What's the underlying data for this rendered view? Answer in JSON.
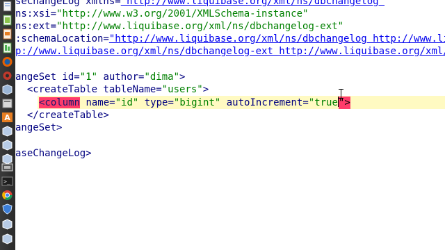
{
  "launcher": {
    "icons": [
      "document-icon",
      "spreadsheet-icon",
      "presentation-icon",
      "spreadsheet-icon-2",
      "firefox-icon",
      "settings-gear-icon",
      "software-center-icon",
      "workspace-icon",
      "font-a-icon",
      "liquibase-icon",
      "liquibase-icon-2",
      "liquibase-icon-3",
      "screenshot-icon",
      "terminal-icon",
      "chrome-icon",
      "shield-icon",
      "liquibase-icon-4",
      "liquibase-icon-5"
    ]
  },
  "editor": {
    "lines": [
      {
        "a": "seChangeLog xmlns=",
        "b": "\"http://www.liquibase.org/xml/ns/dbchangelog\""
      },
      {
        "a": "ns:xsi=",
        "b": "\"http://www.w3.org/2001/XMLSchema-instance\""
      },
      {
        "a": "ns:ext=",
        "b": "\"http://www.liquibase.org/xml/ns/dbchangelog-ext\""
      },
      {
        "a": ":schemaLocation=",
        "b": "\"http://www.liquibase.org/xml/ns/dbchangelog http://www.liqui"
      },
      {
        "a": "p://www.liquibase.org/xml/ns/dbchangelog-ext http://www.liquibase.org/xml/ns/"
      },
      {
        "a": "",
        "b": ""
      },
      {
        "a": "angeSet id=",
        "b": "\"1\"",
        "c": " author=",
        "d": "\"dima\"",
        "e": ">"
      },
      {
        "a": "  <createTable tableName=",
        "b": "\"users\"",
        "e": ">"
      },
      {
        "a": "",
        "b": ""
      },
      {
        "a": "  </createTable>"
      },
      {
        "a": "angeSet>"
      },
      {
        "a": ""
      },
      {
        "a": "aseChangeLog>"
      }
    ],
    "column_line": {
      "tag": "<column",
      "attr1": " name=",
      "val1": "\"id\"",
      "attr2": " type=",
      "val2": "\"bigint\"",
      "attr3": " autoIncrement=",
      "val3": "\"true",
      "end": "\">"
    }
  }
}
